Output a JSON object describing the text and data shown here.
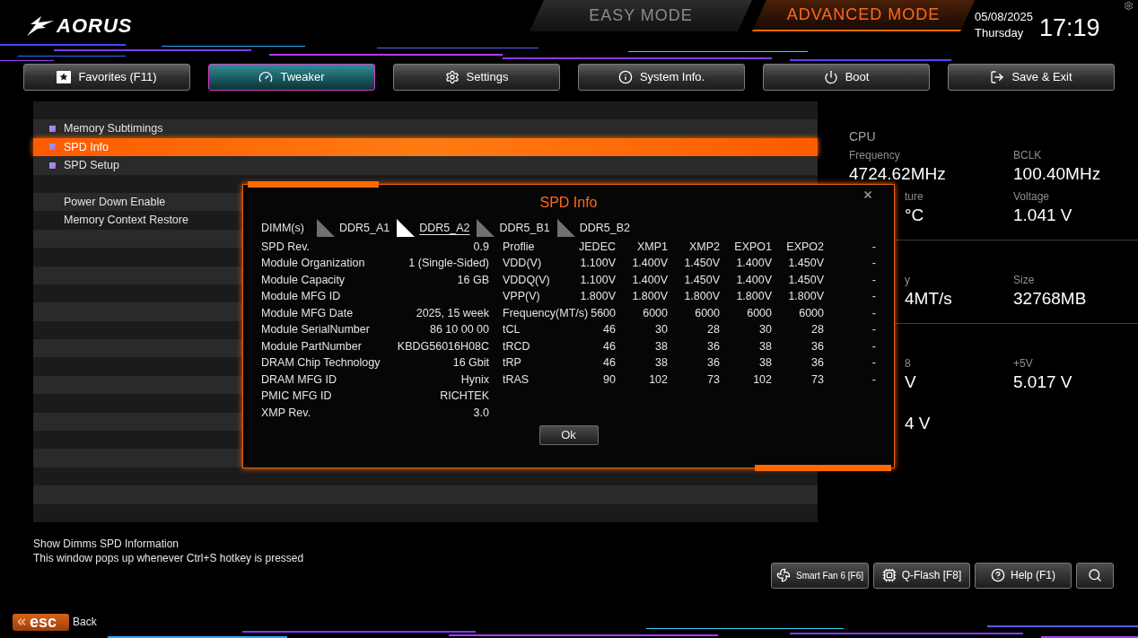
{
  "header": {
    "logo": "AORUS",
    "modes": [
      {
        "label": "EASY MODE",
        "selected": false
      },
      {
        "label": "ADVANCED MODE",
        "selected": true
      }
    ],
    "date": "05/08/2025",
    "weekday": "Thursday",
    "time": "17:19"
  },
  "tabs": [
    {
      "label": "Favorites (F11)",
      "selected": false
    },
    {
      "label": "Tweaker",
      "selected": true
    },
    {
      "label": "Settings",
      "selected": false
    },
    {
      "label": "System Info.",
      "selected": false
    },
    {
      "label": "Boot",
      "selected": false
    },
    {
      "label": "Save & Exit",
      "selected": false
    }
  ],
  "menu": {
    "items": [
      {
        "kind": "spacer",
        "selected": false
      },
      {
        "kind": "submenu",
        "label": "Memory Subtimings",
        "selected": false
      },
      {
        "kind": "submenu",
        "label": "SPD Info",
        "selected": true
      },
      {
        "kind": "submenu",
        "label": "SPD Setup",
        "selected": false
      },
      {
        "kind": "spacer",
        "selected": false
      },
      {
        "kind": "setting",
        "label": "Power Down Enable",
        "selected": false
      },
      {
        "kind": "setting",
        "label": "Memory Context Restore",
        "selected": false
      }
    ]
  },
  "hardware_monitor": {
    "sections": [
      {
        "title": "CPU",
        "items": [
          {
            "kind": "full",
            "label": "Frequency",
            "value": "4724.62MHz"
          },
          {
            "kind": "full",
            "label": "BCLK",
            "value": "100.40MHz"
          },
          {
            "kind": "covered",
            "label": "ture",
            "value": "°C"
          },
          {
            "kind": "full",
            "label": "Voltage",
            "value": "1.041 V"
          }
        ]
      },
      {
        "items": [
          {
            "kind": "covered",
            "label": "y",
            "value": "4MT/s"
          },
          {
            "kind": "full",
            "label": "Size",
            "value": "32768MB"
          }
        ]
      },
      {
        "items": [
          {
            "kind": "covered",
            "label": "8",
            "value": "V"
          },
          {
            "kind": "full",
            "label": "+5V",
            "value": "5.017 V"
          },
          {
            "kind": "covered",
            "value": "4 V"
          }
        ]
      }
    ]
  },
  "help": {
    "lines": [
      "Show Dimms SPD Information",
      "This window pops up whenever Ctrl+S hotkey is pressed"
    ]
  },
  "toolbar": [
    {
      "label": "Smart Fan 6 [F6]"
    },
    {
      "label": "Q-Flash [F8]"
    },
    {
      "label": "Help (F1)"
    }
  ],
  "footer": {
    "key": "esc",
    "label": "Back"
  },
  "spd_dialog": {
    "title": "SPD Info",
    "dimm_label": "DIMM(s)",
    "dimms": [
      {
        "label": "DDR5_A1",
        "selected": false
      },
      {
        "label": "DDR5_A2",
        "selected": true
      },
      {
        "label": "DDR5_B1",
        "selected": false
      },
      {
        "label": "DDR5_B2",
        "selected": false
      }
    ],
    "module_info": [
      {
        "label": "SPD Rev.",
        "value": "0.9"
      },
      {
        "label": "Module Organization",
        "value": "1 (Single-Sided)"
      },
      {
        "label": "Module Capacity",
        "value": "16 GB"
      },
      {
        "label": "Module MFG ID"
      },
      {
        "label": "Module MFG Date",
        "value": "2025, 15 week"
      },
      {
        "label": "Module SerialNumber",
        "value": "86 10 00 00"
      },
      {
        "label": "Module PartNumber",
        "value": "KBDG56016H08C"
      },
      {
        "label": "DRAM Chip Technology",
        "value": "16 Gbit"
      },
      {
        "label": "DRAM MFG ID",
        "value": "Hynix"
      },
      {
        "label": "PMIC MFG ID",
        "value": "RICHTEK"
      },
      {
        "label": "XMP Rev.",
        "value": "3.0"
      }
    ],
    "profiles": {
      "columns": [
        "Proflie",
        "JEDEC",
        "XMP1",
        "XMP2",
        "EXPO1",
        "EXPO2",
        "-"
      ],
      "rows": [
        {
          "label": "VDD(V)",
          "values": [
            "1.100V",
            "1.400V",
            "1.450V",
            "1.400V",
            "1.450V",
            "-"
          ]
        },
        {
          "label": "VDDQ(V)",
          "values": [
            "1.100V",
            "1.400V",
            "1.450V",
            "1.400V",
            "1.450V",
            "-"
          ]
        },
        {
          "label": "VPP(V)",
          "values": [
            "1.800V",
            "1.800V",
            "1.800V",
            "1.800V",
            "1.800V",
            "-"
          ]
        },
        {
          "label": "Frequency(MT/s)",
          "values": [
            "5600",
            "6000",
            "6000",
            "6000",
            "6000",
            "-"
          ]
        },
        {
          "label": "tCL",
          "values": [
            "46",
            "30",
            "28",
            "30",
            "28",
            "-"
          ]
        },
        {
          "label": "tRCD",
          "values": [
            "46",
            "38",
            "36",
            "38",
            "36",
            "-"
          ]
        },
        {
          "label": "tRP",
          "values": [
            "46",
            "38",
            "36",
            "38",
            "36",
            "-"
          ]
        },
        {
          "label": "tRAS",
          "values": [
            "90",
            "102",
            "73",
            "102",
            "73",
            "-"
          ]
        }
      ]
    },
    "ok_button": "Ok"
  }
}
